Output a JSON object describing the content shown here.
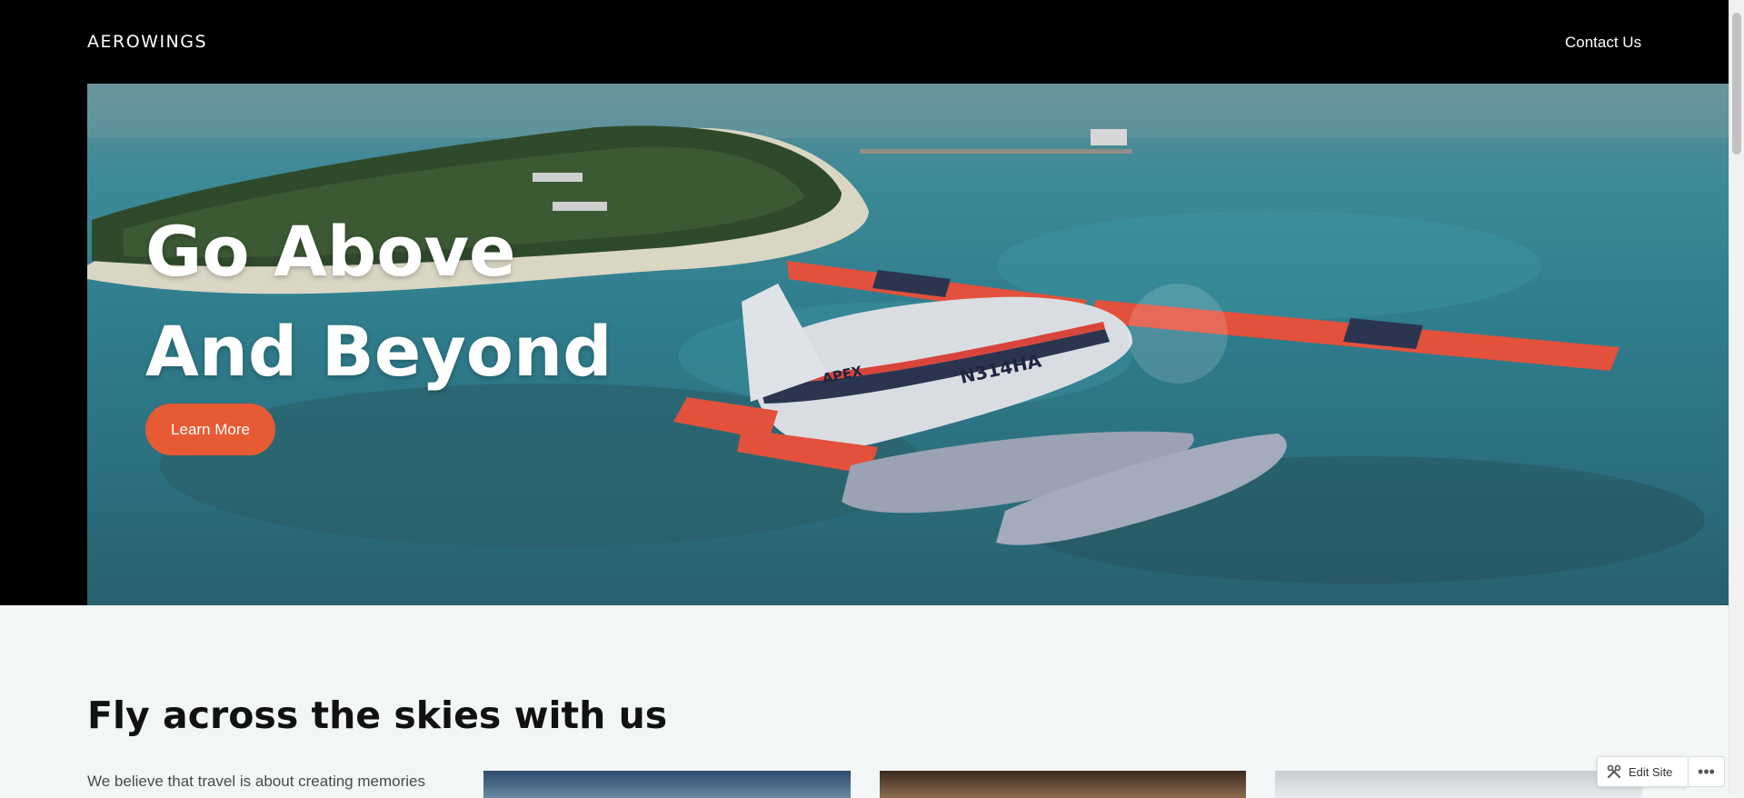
{
  "header": {
    "logo": "AEROWINGS",
    "nav": {
      "contact": "Contact Us"
    }
  },
  "hero": {
    "title_line1": "Go Above",
    "title_line2": "And Beyond",
    "button": "Learn More",
    "image_icon": "seaplane-over-island-image",
    "aircraft_registration": "N314HA",
    "aircraft_logo": "APEX"
  },
  "section": {
    "title": "Fly across the skies with us",
    "intro": "We believe that travel is about creating memories"
  },
  "admin_bar": {
    "edit_site": "Edit Site",
    "more": "•••"
  },
  "colors": {
    "accent": "#e65a34",
    "header_bg": "#000000",
    "page_bg": "#f2f6f6"
  }
}
